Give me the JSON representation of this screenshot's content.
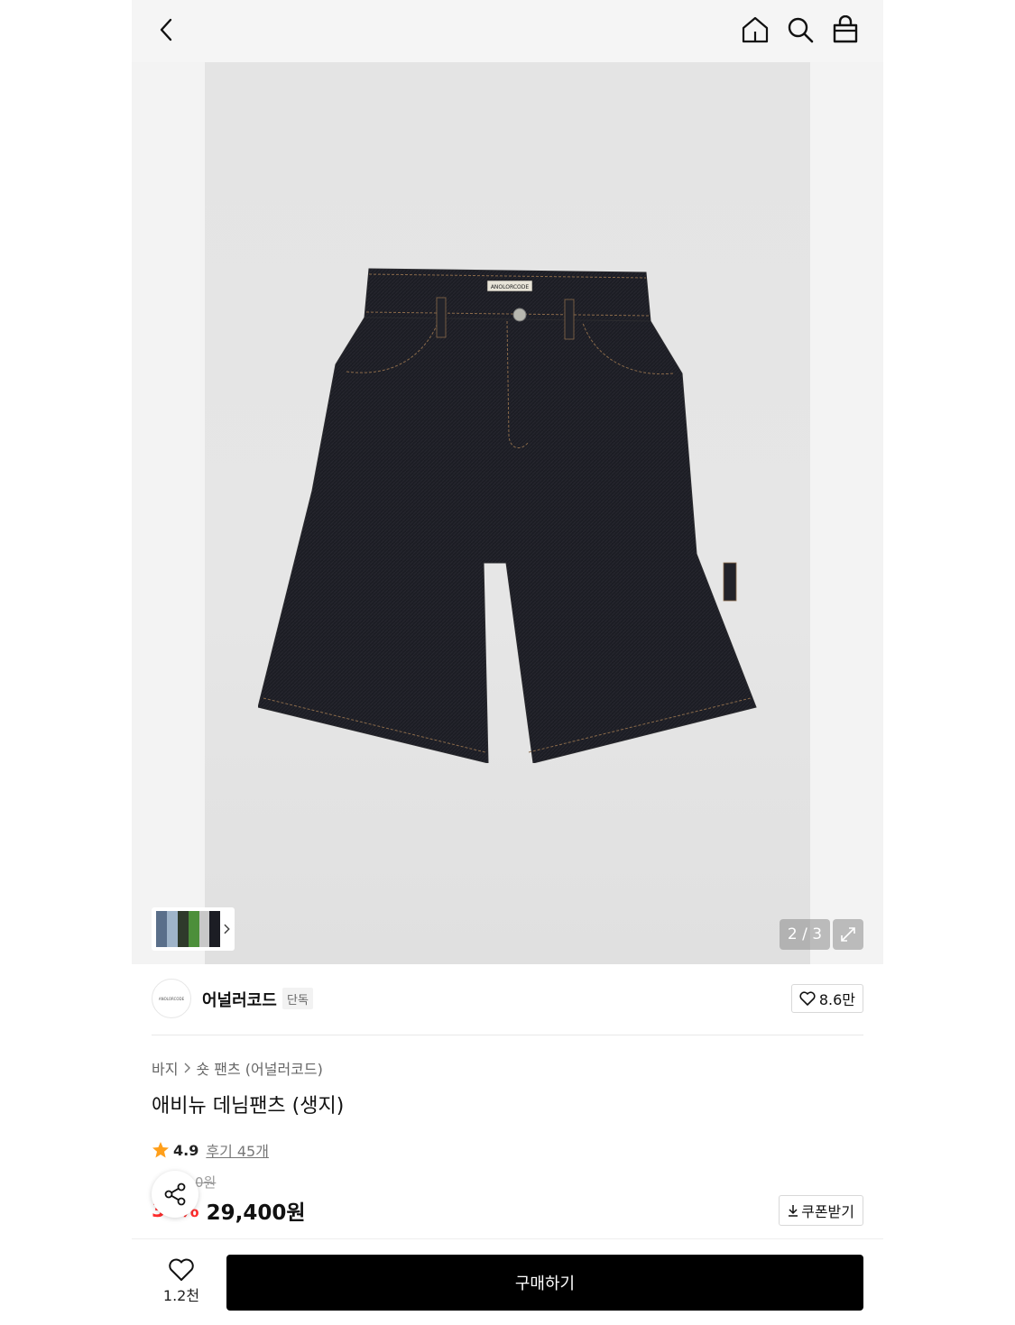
{
  "header": {
    "icons": [
      "chevron-left-icon",
      "home-icon",
      "search-icon",
      "shopping-bag-icon"
    ]
  },
  "gallery": {
    "counter": "2 / 3",
    "product_image": "black raw denim carpenter shorts with ANOLORCODE label",
    "label_text": "ANOLORCODE"
  },
  "brand": {
    "logo_text": "ANOLORCODE",
    "name": "어널러코드",
    "badge": "단독",
    "likes": "8.6만"
  },
  "product": {
    "breadcrumb": [
      "바지",
      "숏 팬츠 (어널러코드)"
    ],
    "title": "애비뉴 데님팬츠 (생지)",
    "rating": "4.9",
    "reviews": "후기 45개",
    "original_price": "0원",
    "discount": "30%",
    "price": "29,400원",
    "coupon_label": "쿠폰받기"
  },
  "bottom_bar": {
    "wish_count": "1.2천",
    "buy_label": "구매하기"
  },
  "colors": {
    "accent_discount": "#ff2d2d",
    "buy_button": "#000000",
    "star": "#ff9f1a"
  }
}
